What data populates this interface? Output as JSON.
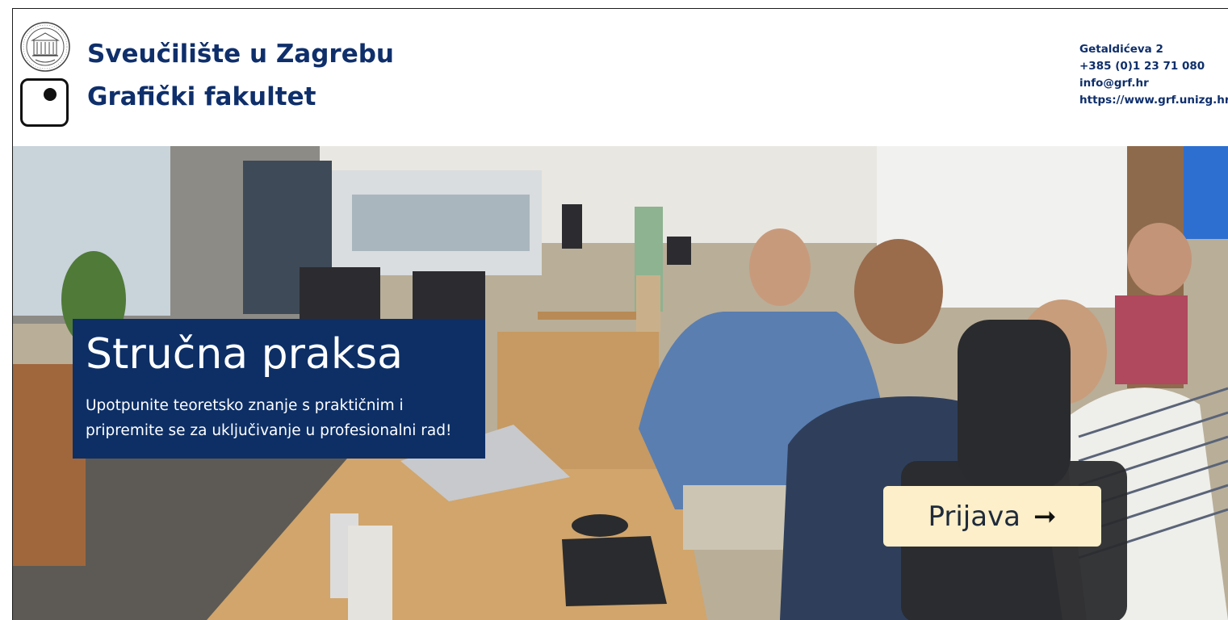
{
  "header": {
    "university": "Sveučilište u Zagrebu",
    "faculty": "Grafički fakultet",
    "contact": {
      "address": "Getaldićeva 2",
      "phone": "+385 (0)1 23 71 080",
      "email": "info@grf.hr",
      "website": "https://www.grf.unizg.hr"
    }
  },
  "hero": {
    "title": "Stručna praksa",
    "subtitle": "Upotpunite teoretsko znanje s praktičnim i pripremite se za uključivanje u profesionalni rad!",
    "cta_label": "Prijava",
    "cta_arrow": "➞"
  },
  "colors": {
    "brand_navy": "#0f2f6b",
    "panel_navy": "#0d2f66",
    "cta_background": "#fcefc9"
  },
  "icons": {
    "seal": "university-seal-icon",
    "faculty_logo": "dot-square-logo-icon",
    "cta_arrow": "arrow-right-icon"
  }
}
